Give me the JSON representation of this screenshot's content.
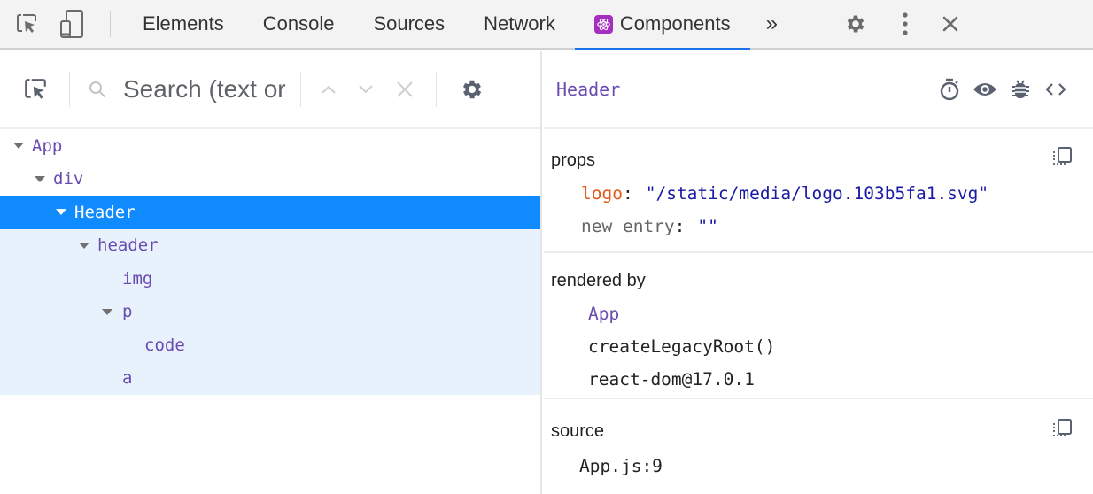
{
  "toolbar": {
    "tabs": [
      {
        "label": "Elements",
        "active": false
      },
      {
        "label": "Console",
        "active": false
      },
      {
        "label": "Sources",
        "active": false
      },
      {
        "label": "Network",
        "active": false
      },
      {
        "label": "Components",
        "active": true,
        "icon": "react-atom-icon"
      }
    ],
    "more_tabs_label": "»",
    "accent_color": "#1a73e8"
  },
  "left_panel": {
    "search": {
      "placeholder": "Search (text or /regex/)",
      "value": ""
    },
    "tree": [
      {
        "label": "App",
        "depth": 0,
        "expanded": true,
        "state": "normal"
      },
      {
        "label": "div",
        "depth": 1,
        "expanded": true,
        "state": "normal"
      },
      {
        "label": "Header",
        "depth": 2,
        "expanded": true,
        "state": "selected"
      },
      {
        "label": "header",
        "depth": 3,
        "expanded": true,
        "state": "subtree"
      },
      {
        "label": "img",
        "depth": 4,
        "expanded": null,
        "state": "subtree"
      },
      {
        "label": "p",
        "depth": 4,
        "expanded": true,
        "state": "subtree"
      },
      {
        "label": "code",
        "depth": 5,
        "expanded": null,
        "state": "subtree"
      },
      {
        "label": "a",
        "depth": 4,
        "expanded": null,
        "state": "subtree"
      }
    ],
    "selected_color": "#0f8aff"
  },
  "right_panel": {
    "title": "Header",
    "props": {
      "label": "props",
      "items": [
        {
          "key": "logo",
          "value": "\"/static/media/logo.103b5fa1.svg\""
        },
        {
          "key": "new entry",
          "value": "\"\""
        }
      ]
    },
    "rendered_by": {
      "label": "rendered by",
      "items": [
        "App",
        "createLegacyRoot()",
        "react-dom@17.0.1"
      ]
    },
    "source": {
      "label": "source",
      "value": "App.js:9"
    }
  }
}
